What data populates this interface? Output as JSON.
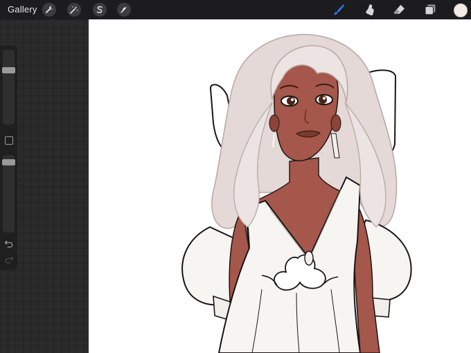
{
  "toolbar": {
    "gallery_label": "Gallery",
    "left_tools": [
      "wrench-icon",
      "magic-wand-icon",
      "selection-s-icon",
      "transform-arrow-icon"
    ],
    "right_tools": [
      "brush-icon",
      "smudge-icon",
      "eraser-icon",
      "layers-icon"
    ],
    "active_tool": "brush-icon",
    "active_color": "#f3ece4",
    "accent_color": "#2f7bf5"
  },
  "sidebar": {
    "brush_size_level": 0.25,
    "opacity_level": 0.0,
    "controls": [
      "brush-size-slider",
      "modify-button",
      "opacity-slider",
      "undo-button",
      "redo-button"
    ]
  },
  "canvas": {
    "content": "illustration",
    "colors": {
      "skin": "#a4574a",
      "skin_shadow": "#8c4438",
      "hair": "#ece4e2",
      "hair_shadow": "#d4c3c1",
      "dress": "#f7f5f2",
      "lineart": "#1a1414"
    }
  }
}
